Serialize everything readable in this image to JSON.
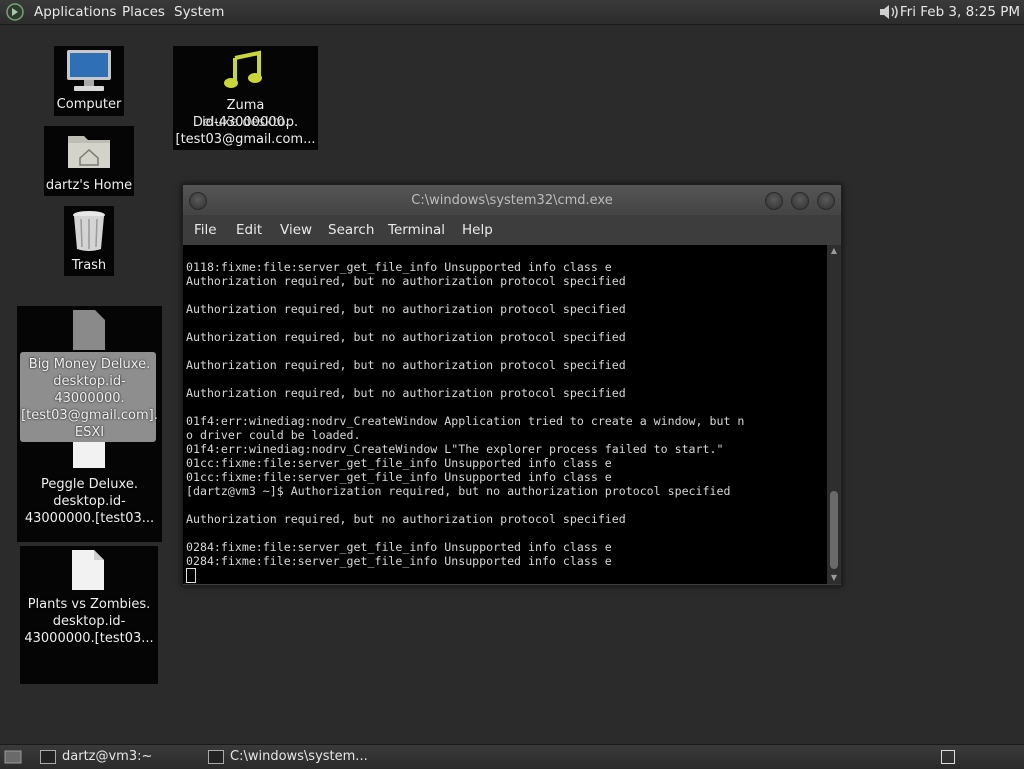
{
  "top_panel": {
    "menus": [
      "Applications",
      "Places",
      "System"
    ],
    "clock": "Fri Feb  3,  8:25 PM",
    "volume_icon": "speaker-icon"
  },
  "desktop_icons": {
    "computer": "Computer",
    "zuma": [
      "Zuma Deluxe.desktop.",
      "id-43000000.",
      "[test03@gmail.com..."
    ],
    "home": "dartz's Home",
    "trash": "Trash",
    "bigmoney": [
      "Big Money Deluxe.",
      "desktop.id-",
      "43000000.",
      "[test03@gmail.com].",
      "ESXI"
    ],
    "peggle": [
      "Peggle Deluxe.",
      "desktop.id-",
      "43000000.[test03..."
    ],
    "plants": [
      "Plants vs Zombies.",
      "desktop.id-",
      "43000000.[test03..."
    ]
  },
  "window": {
    "title": "C:\\windows\\system32\\cmd.exe",
    "menu": [
      "File",
      "Edit",
      "View",
      "Search",
      "Terminal",
      "Help"
    ],
    "lines": [
      "0118:fixme:file:server_get_file_info Unsupported info class e",
      "Authorization required, but no authorization protocol specified",
      "",
      "Authorization required, but no authorization protocol specified",
      "",
      "Authorization required, but no authorization protocol specified",
      "",
      "Authorization required, but no authorization protocol specified",
      "",
      "Authorization required, but no authorization protocol specified",
      "",
      "01f4:err:winediag:nodrv_CreateWindow Application tried to create a window, but n",
      "o driver could be loaded.",
      "01f4:err:winediag:nodrv_CreateWindow L\"The explorer process failed to start.\"",
      "01cc:fixme:file:server_get_file_info Unsupported info class e",
      "01cc:fixme:file:server_get_file_info Unsupported info class e",
      "[dartz@vm3 ~]$ Authorization required, but no authorization protocol specified",
      "",
      "Authorization required, but no authorization protocol specified",
      "",
      "0284:fixme:file:server_get_file_info Unsupported info class e",
      "0284:fixme:file:server_get_file_info Unsupported info class e"
    ]
  },
  "bottom_panel": {
    "tasks": [
      "dartz@vm3:~",
      "C:\\windows\\system..."
    ]
  }
}
